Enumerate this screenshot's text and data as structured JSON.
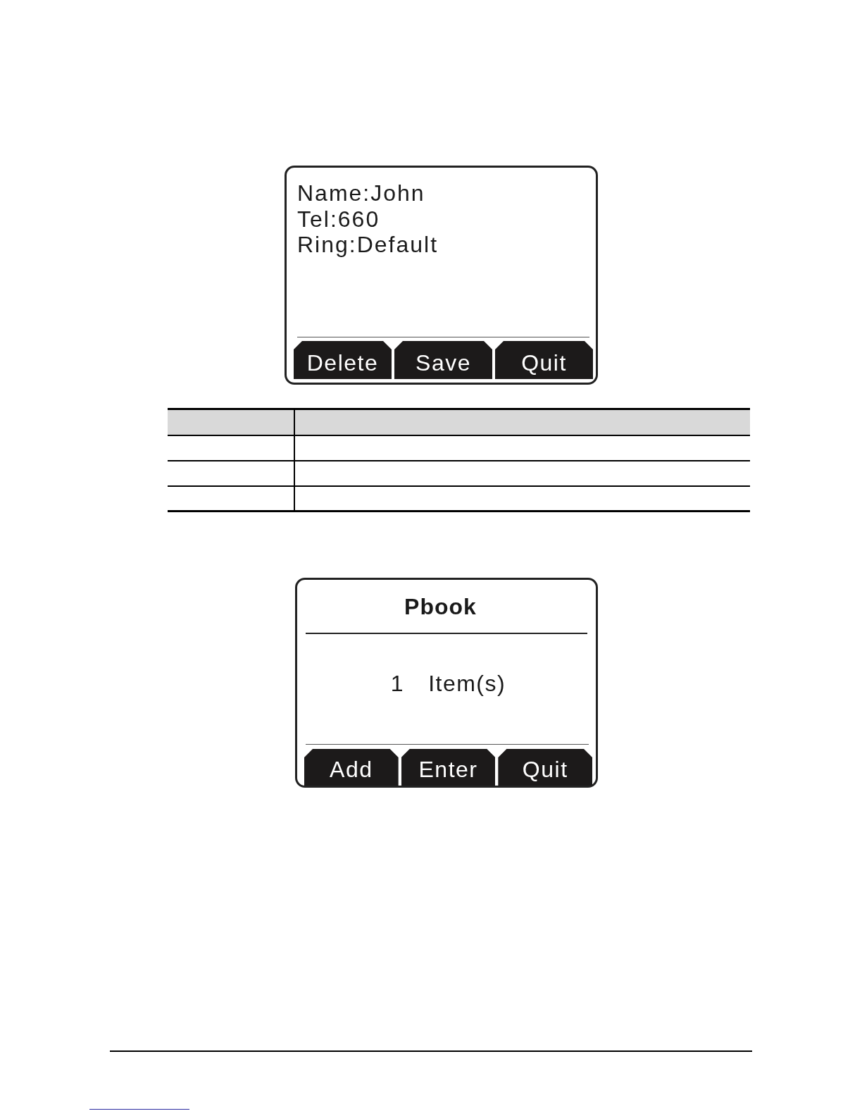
{
  "contact_screen": {
    "lines": [
      "Name:John",
      "Tel:660",
      "Ring:Default"
    ],
    "softkeys": [
      "Delete",
      "Save",
      "Quit"
    ]
  },
  "pbook_screen": {
    "title": "Pbook",
    "count": "1",
    "label": "Item(s)",
    "softkeys": [
      "Add",
      "Enter",
      "Quit"
    ]
  }
}
